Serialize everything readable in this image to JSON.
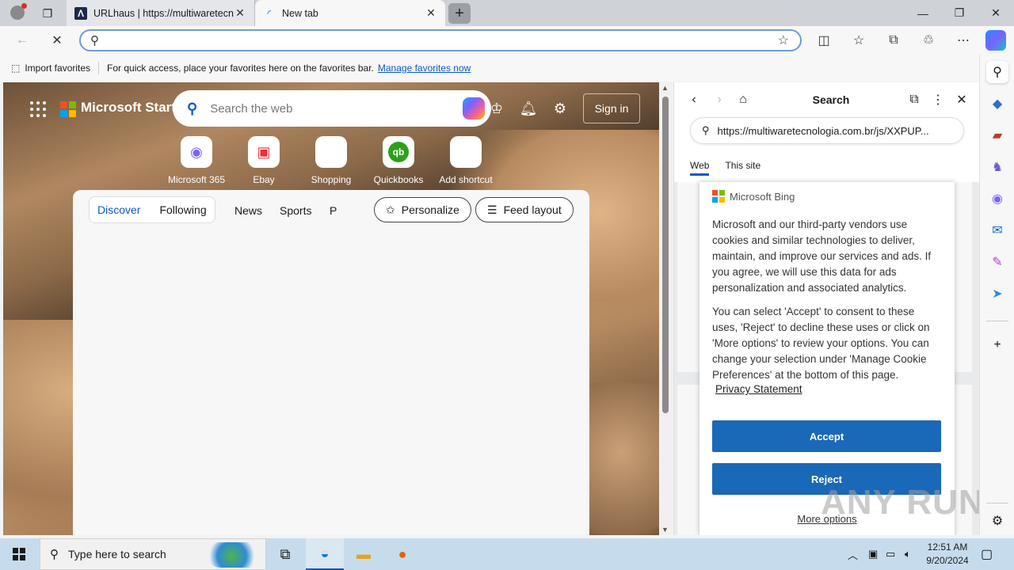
{
  "tabs": [
    {
      "title": "URLhaus | https://multiwaretecn",
      "icon": "urlhaus-icon"
    },
    {
      "title": "New tab",
      "icon": "loading-icon"
    }
  ],
  "favorites_bar": {
    "import_label": "Import favorites",
    "hint": "For quick access, place your favorites here on the favorites bar.",
    "manage_link": "Manage favorites now"
  },
  "start_page": {
    "brand": "Microsoft Start",
    "search_placeholder": "Search the web",
    "sign_in": "Sign in",
    "shortcuts": [
      {
        "label": "Microsoft 365"
      },
      {
        "label": "Ebay"
      },
      {
        "label": "Shopping"
      },
      {
        "label": "Quickbooks"
      },
      {
        "label": "Add shortcut"
      }
    ],
    "feed_tabs": [
      "Discover",
      "Following"
    ],
    "feed_more": [
      "News",
      "Sports",
      "P"
    ],
    "personalize": "Personalize",
    "feed_layout": "Feed layout"
  },
  "search_panel": {
    "title": "Search",
    "url": "https://multiwaretecnologia.com.br/js/XXPUP...",
    "tabs": [
      "Web",
      "This site"
    ],
    "consent": {
      "brand": "Microsoft Bing",
      "para1": "Microsoft and our third-party vendors use cookies and similar technologies to deliver, maintain, and improve our services and ads. If you agree, we will use this data for ads personalization and associated analytics.",
      "para2": "You can select 'Accept' to consent to these uses, 'Reject' to decline these uses or click on 'More options' to review your options. You can change your selection under 'Manage Cookie Preferences' at the bottom of this page.",
      "privacy": "Privacy Statement",
      "accept": "Accept",
      "reject": "Reject",
      "more": "More options"
    }
  },
  "taskbar": {
    "search_placeholder": "Type here to search",
    "time": "12:51 AM",
    "date": "9/20/2024"
  },
  "watermark": "ANY RUN",
  "colors": {
    "accent": "#0b57d0",
    "consent_button": "#1a68b8"
  }
}
